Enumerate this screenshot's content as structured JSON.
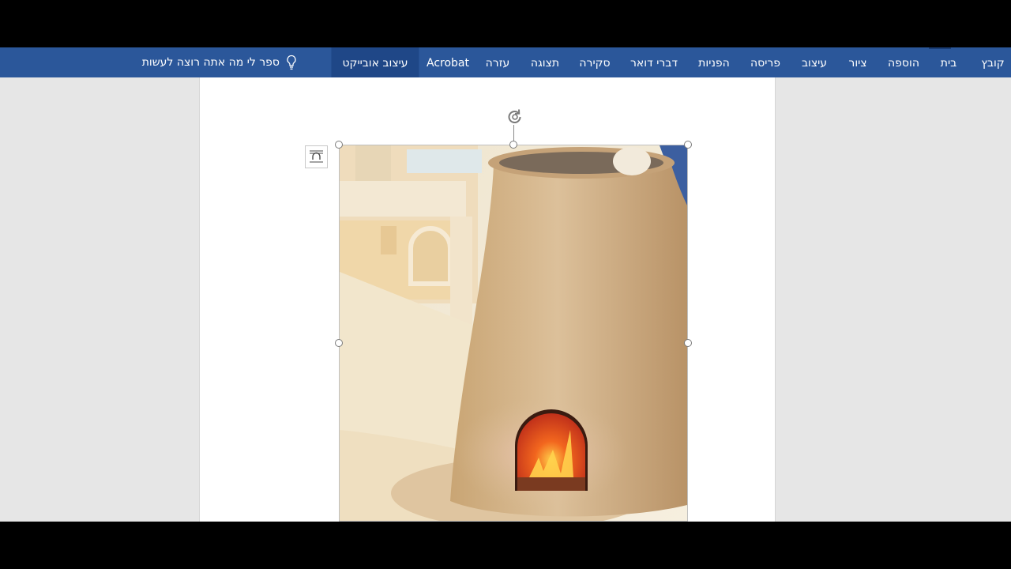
{
  "ribbon": {
    "tabs": [
      {
        "id": "file",
        "label": "קובץ"
      },
      {
        "id": "home",
        "label": "בית"
      },
      {
        "id": "insert",
        "label": "הוספה"
      },
      {
        "id": "draw",
        "label": "ציור"
      },
      {
        "id": "design",
        "label": "עיצוב"
      },
      {
        "id": "layout",
        "label": "פריסה"
      },
      {
        "id": "references",
        "label": "הפניות"
      },
      {
        "id": "mailings",
        "label": "דברי דואר"
      },
      {
        "id": "review",
        "label": "סקירה"
      },
      {
        "id": "view",
        "label": "תצוגה"
      },
      {
        "id": "help",
        "label": "עזרה"
      },
      {
        "id": "acrobat",
        "label": "Acrobat"
      },
      {
        "id": "picture-format",
        "label": "עיצוב אובייקט"
      }
    ],
    "tell_me": "ספר לי מה אתה רוצה לעשות",
    "accent_color": "#2b579a"
  },
  "document": {
    "selected_object": "picture",
    "image_subject": "clay tabun oven with fire opening"
  }
}
